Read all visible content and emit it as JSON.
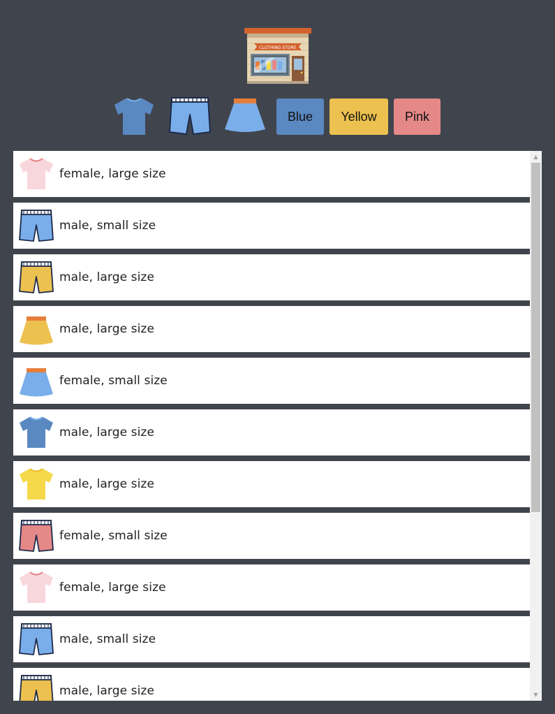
{
  "logo": {
    "name": "clothing-store-logo",
    "sign_text": "CLOTHING STORE"
  },
  "filters": {
    "type_icons": [
      "tshirt",
      "shorts",
      "skirt"
    ],
    "colors": [
      {
        "label": "Blue",
        "bg": "#5a88c1"
      },
      {
        "label": "Yellow",
        "bg": "#edc14f"
      },
      {
        "label": "Pink",
        "bg": "#e58888"
      }
    ]
  },
  "palette": {
    "blue": "#5a88c1",
    "light_blue": "#7aaeea",
    "yellow": "#edc14f",
    "tee_yellow": "#f5d94a",
    "pink": "#e58888",
    "light_pink": "#f8d7dc",
    "waistband_orange": "#e87e3a"
  },
  "items": [
    {
      "type": "tshirt",
      "color": "light_pink",
      "text": "female, large size"
    },
    {
      "type": "shorts",
      "color": "light_blue",
      "text": "male, small size"
    },
    {
      "type": "shorts",
      "color": "yellow",
      "text": "male, large size"
    },
    {
      "type": "skirt",
      "color": "yellow",
      "text": "male, large size"
    },
    {
      "type": "skirt",
      "color": "light_blue",
      "text": "female, small size"
    },
    {
      "type": "tshirt",
      "color": "blue",
      "text": "male, large size"
    },
    {
      "type": "tshirt",
      "color": "tee_yellow",
      "text": "male, large size"
    },
    {
      "type": "shorts",
      "color": "pink",
      "text": "female, small size"
    },
    {
      "type": "tshirt",
      "color": "light_pink",
      "text": "female, large size"
    },
    {
      "type": "shorts",
      "color": "light_blue",
      "text": "male, small size"
    },
    {
      "type": "shorts",
      "color": "yellow",
      "text": "male, large size"
    }
  ]
}
